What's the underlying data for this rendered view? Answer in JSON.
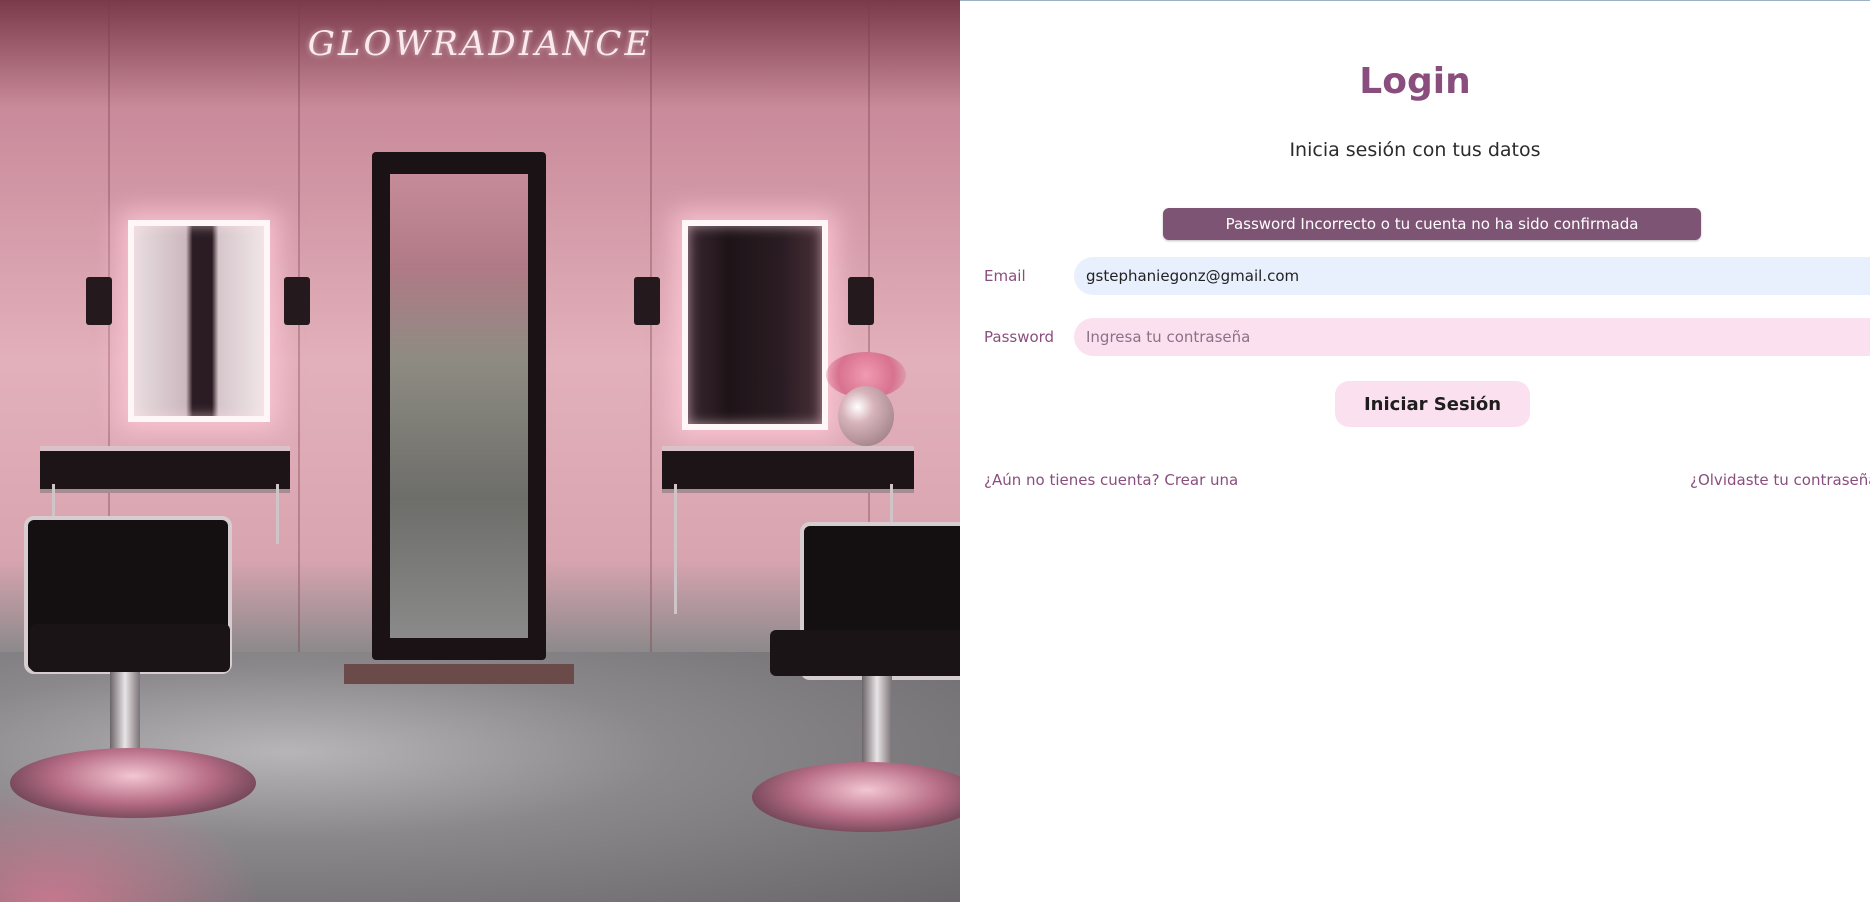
{
  "hero": {
    "brand": "GLOWRADIANCE",
    "image_description_icon": "salon-photo"
  },
  "auth": {
    "title": "Login",
    "subtitle": "Inicia sesión con tus datos",
    "alert": "Password Incorrecto o tu cuenta no ha sido confirmada",
    "email": {
      "label": "Email",
      "value": "gstephaniegonz@gmail.com",
      "placeholder": ""
    },
    "password": {
      "label": "Password",
      "value": "",
      "placeholder": "Ingresa tu contraseña"
    },
    "submit_label": "Iniciar Sesión",
    "register_link": "¿Aún no tienes cuenta? Crear una",
    "forgot_link": "¿Olvidaste tu contraseña"
  },
  "colors": {
    "accent": "#8a4e7e",
    "alert_bg": "#7d5473",
    "button_bg": "#fbe1ef",
    "email_bg": "#e8f0fe",
    "password_bg": "#fbe1ef"
  }
}
